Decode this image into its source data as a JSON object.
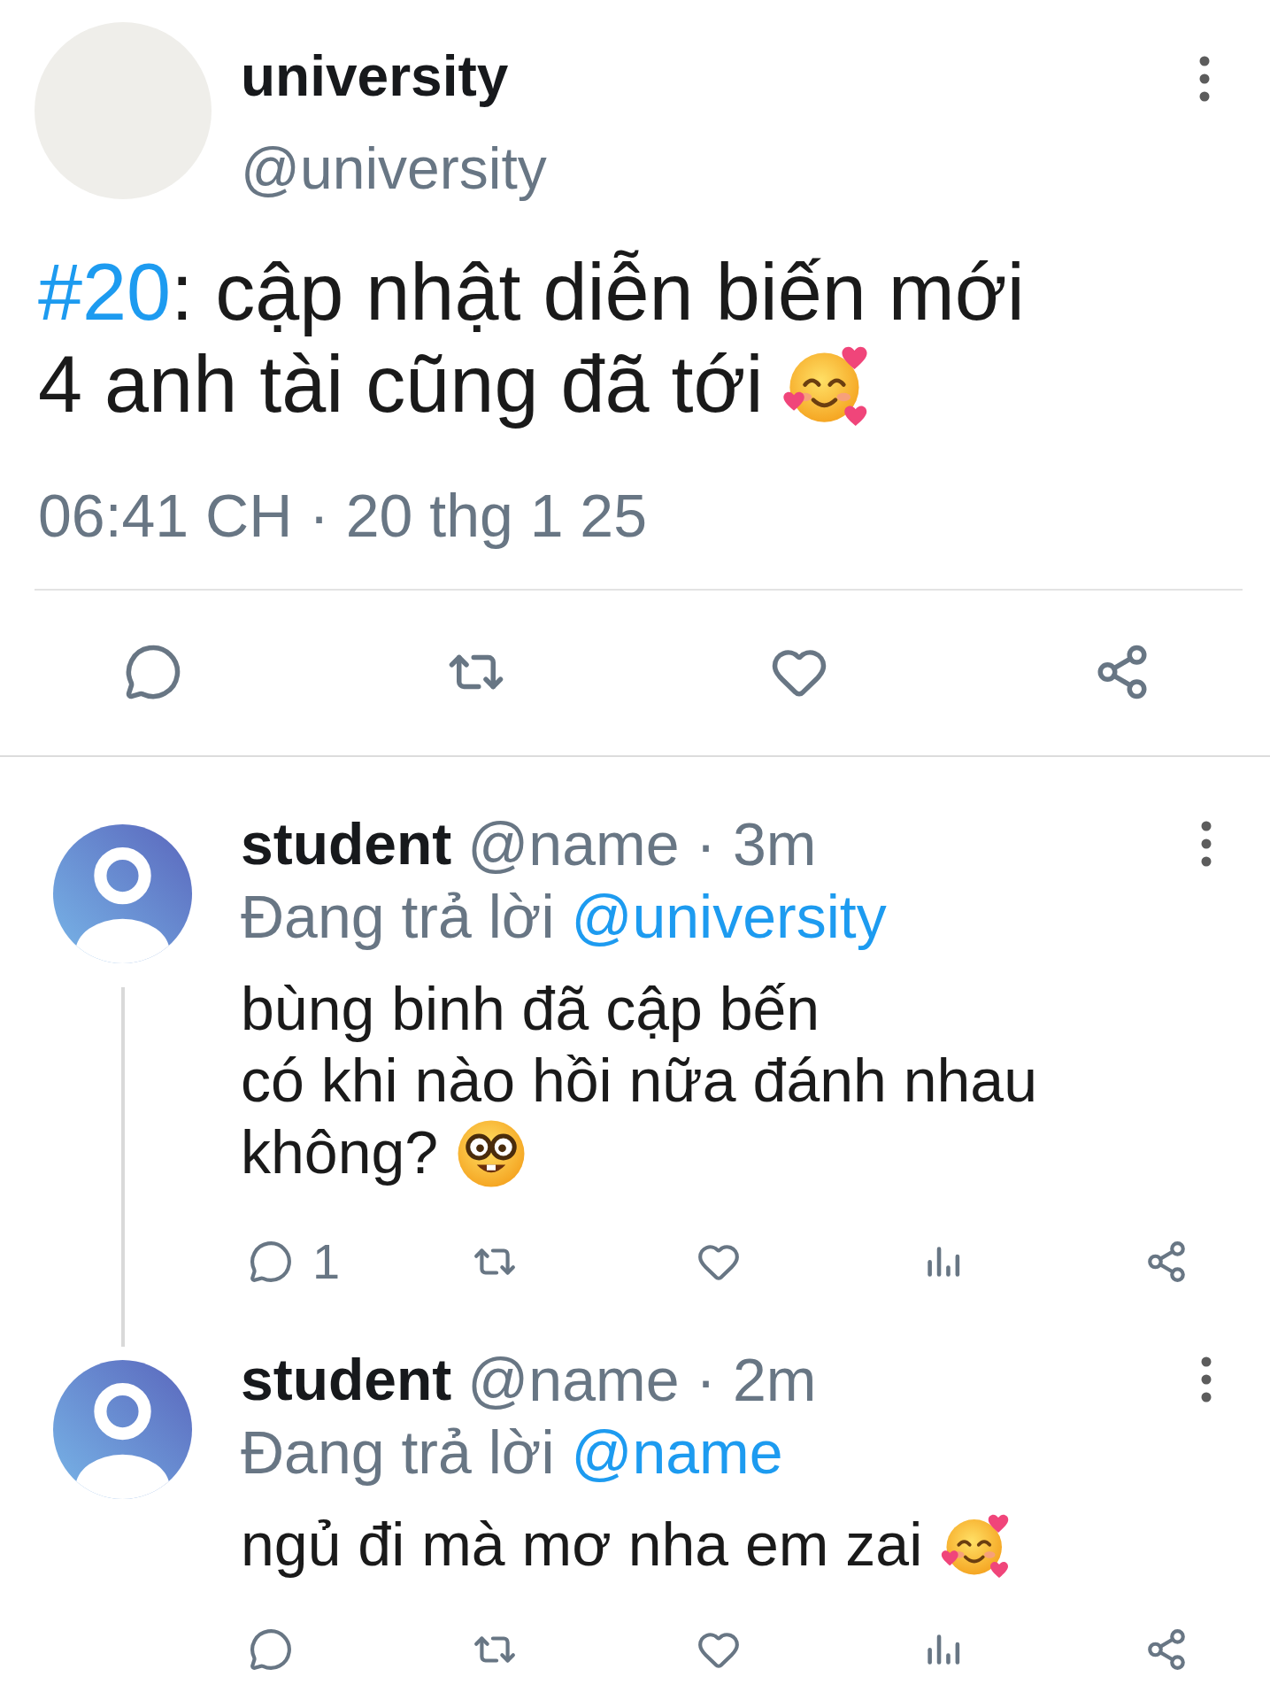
{
  "tweet": {
    "author": {
      "name": "university",
      "handle": "@university"
    },
    "text": [
      {
        "kind": "hashtag",
        "text": "#20"
      },
      {
        "kind": "plain",
        "text": ": cập nhật diễn biến mới\n4 anh tài cũng đã tới"
      }
    ],
    "emoji": {
      "kind": "smiling_face_with_hearts"
    },
    "timestamp": "06:41 CH · 20 thg 1 25",
    "actions": [
      {
        "kind": "reply"
      },
      {
        "kind": "retweet"
      },
      {
        "kind": "like"
      },
      {
        "kind": "share"
      }
    ]
  },
  "replies": [
    {
      "name": "student",
      "meta": "@name · 3m",
      "replying_label": "Đang trả lời",
      "replying_to": "@university",
      "text": "bùng binh đã cập bến\ncó khi nào hồi nữa đánh nhau không?",
      "emoji": {
        "kind": "nerd_face"
      },
      "thread_continues": true,
      "actions": [
        {
          "kind": "reply",
          "count": "1"
        },
        {
          "kind": "retweet"
        },
        {
          "kind": "like"
        },
        {
          "kind": "views"
        },
        {
          "kind": "share"
        }
      ]
    },
    {
      "name": "student",
      "meta": "@name · 2m",
      "replying_label": "Đang trả lời",
      "replying_to": "@name",
      "text": "ngủ đi mà mơ nha em zai",
      "emoji": {
        "kind": "smiling_face_with_hearts"
      },
      "thread_continues": false,
      "actions": [
        {
          "kind": "reply"
        },
        {
          "kind": "retweet"
        },
        {
          "kind": "like"
        },
        {
          "kind": "views"
        },
        {
          "kind": "share"
        }
      ]
    }
  ]
}
